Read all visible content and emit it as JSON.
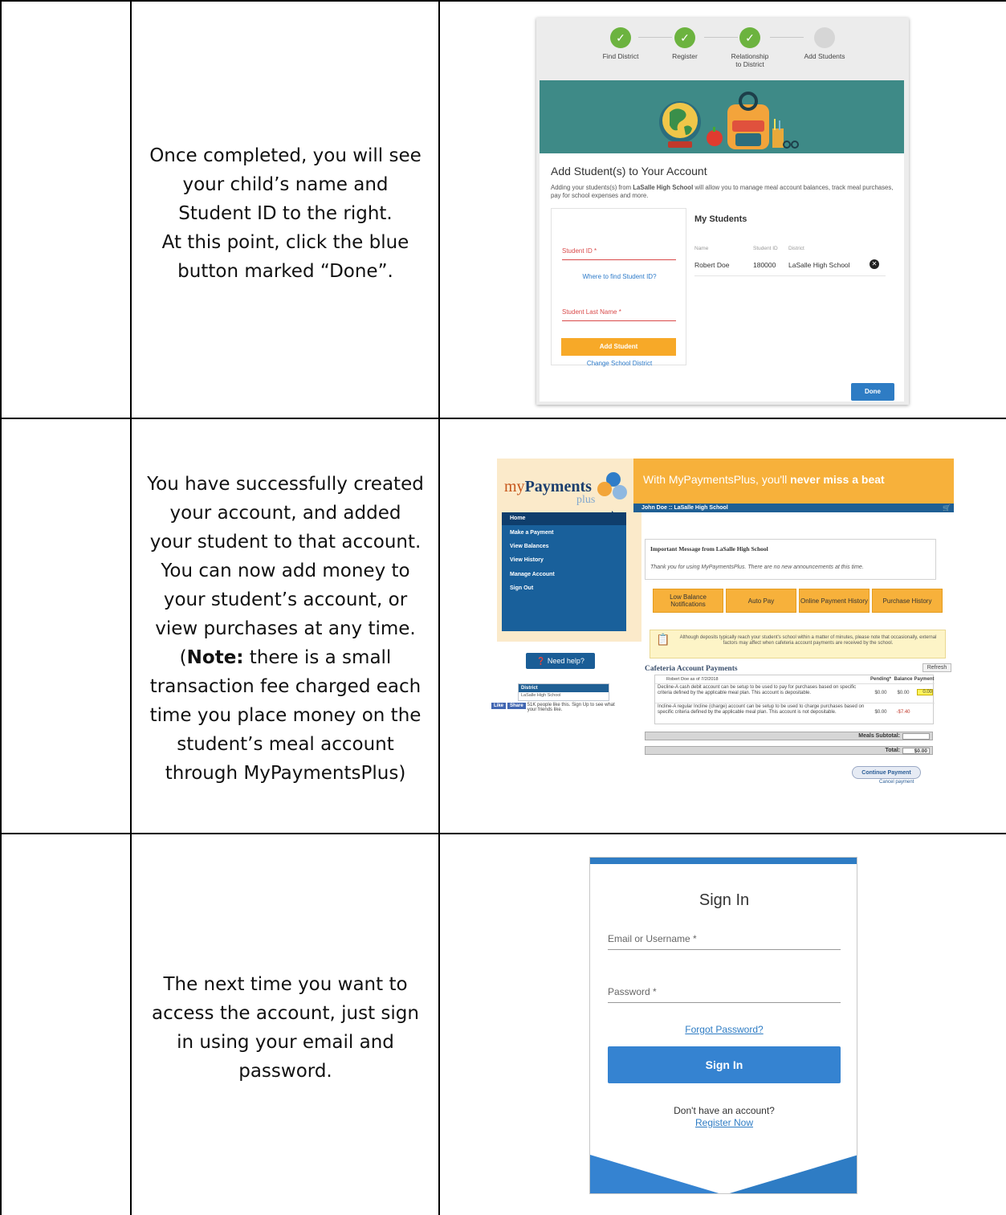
{
  "rows": [
    {
      "instruction": [
        "Once completed, you will see",
        "your child’s name and",
        "Student ID to the right.",
        "At this point, click the blue",
        "button marked “Done”."
      ]
    },
    {
      "instruction_lines": [
        "You have successfully created",
        "your account, and added",
        "your student to that account.",
        "You can now add money to",
        "your student’s account, or",
        "view purchases at any time."
      ],
      "note_label": "Note:",
      "note_open": "(",
      "note_rest_first": " there is a small",
      "note_lines": [
        "transaction fee charged each",
        "time you place money on the",
        "student’s meal account",
        "through MyPaymentsPlus)"
      ]
    },
    {
      "instruction": [
        "The next time you want to",
        "access the account, just sign",
        "in using your email and",
        "password."
      ]
    }
  ],
  "add_student": {
    "steps": [
      "Find District",
      "Register",
      "Relationship to District",
      "Add Students"
    ],
    "step_check": "✓",
    "title": "Add Student(s) to Your Account",
    "desc_pre": "Adding your students(s) from ",
    "desc_school": "LaSalle High School",
    "desc_post": " will allow you to manage meal account balances, track meal purchases, pay for school expenses and more.",
    "student_id_label": "Student ID *",
    "where_link": "Where to find Student ID?",
    "last_name_label": "Student Last Name *",
    "add_button": "Add Student",
    "change_district": "Change School District",
    "my_students": "My Students",
    "col_name": "Name",
    "col_id": "Student ID",
    "col_district": "District",
    "student_name": "Robert Doe",
    "student_id": "180000",
    "student_district": "LaSalle High School",
    "remove_glyph": "✕",
    "done_button": "Done",
    "colors": {
      "banner": "#3e8a87",
      "done": "#2e7cc4",
      "add": "#f7a928",
      "check": "#6cb33f"
    }
  },
  "mpp": {
    "logo_my": "my",
    "logo_payments": "Payments",
    "logo_plus": "plus",
    "tagline_pre": "With MyPaymentsPlus, you'll ",
    "tagline_bold": "never miss a beat",
    "user_bar": "John Doe :: LaSalle High School",
    "nav": [
      "Home",
      "Make a Payment",
      "View Balances",
      "View History",
      "Manage Account",
      "Sign Out"
    ],
    "need_help": "Need help?",
    "district_label": "District",
    "district_value": "LaSalle High School",
    "fb_like": "Like",
    "fb_share": "Share",
    "fb_text": "51K people like this. Sign Up to see what your friends like.",
    "message_title": "Important Message from LaSalle High School",
    "message_body": "Thank you for using MyPaymentsPlus. There are no new announcements at this time.",
    "buttons": [
      "Low Balance Notifications",
      "Auto Pay",
      "Online Payment History",
      "Purchase History"
    ],
    "notice": "Although deposits typically reach your student's school within a matter of minutes, please note that occasionally, external factors may affect when cafeteria account payments are received by the school.",
    "cafeteria_title": "Cafeteria Account Payments",
    "refresh": "Refresh",
    "table_caption": "Robert Doe as of 7/2/2018",
    "col_pending": "Pending*",
    "col_balance": "Balance",
    "col_payment": "Payment",
    "row1_text": "Decline-A cash debit account can be setup to be used to pay for purchases based on specific criteria defined by the applicable meal plan. This account is depositable.",
    "row1_pending": "$0.00",
    "row1_balance": "$0.00",
    "row1_payment": "0.00",
    "row2_text": "Incline-A regular Incline (charge) account can be setup to be used to charge purchases based on specific criteria defined by the applicable meal plan. This account is not depositable.",
    "row2_pending": "$0.00",
    "row2_balance": "-$7.40",
    "meals_subtotal": "Meals Subtotal:",
    "total": "Total:",
    "total_value": "$0.00",
    "continue": "Continue Payment",
    "cancel": "Cancel payment",
    "colors": {
      "header": "#f7b13b",
      "nav": "#19609b",
      "bar": "#1f5f94"
    }
  },
  "signin": {
    "title": "Sign In",
    "email_label": "Email or Username *",
    "password_label": "Password *",
    "forgot": "Forgot Password?",
    "button": "Sign In",
    "dont_have": "Don't have an account?",
    "register": "Register Now",
    "colors": {
      "accent": "#2e7cc4",
      "button": "#3583d1"
    }
  }
}
